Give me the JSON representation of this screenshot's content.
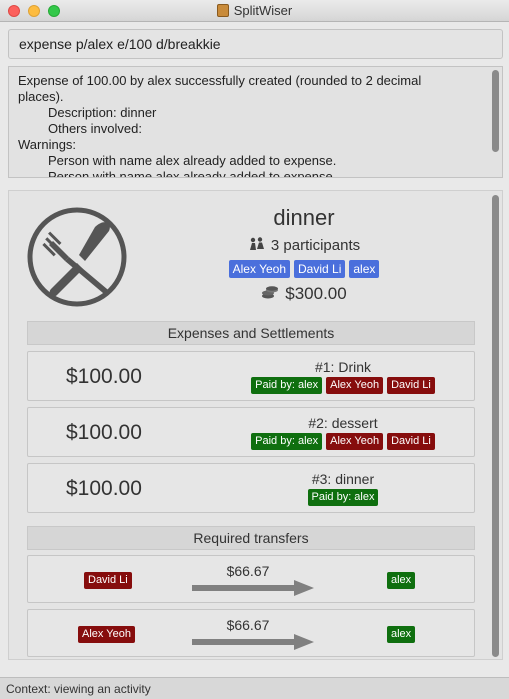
{
  "window": {
    "title": "SplitWiser"
  },
  "command": {
    "value": "expense p/alex e/100 d/breakkie"
  },
  "result": {
    "lines": [
      "Expense of 100.00 by alex successfully created (rounded to 2 decimal",
      "places).",
      "Description: dinner",
      "Others involved:",
      "Warnings:",
      "Person with name alex already added to expense.",
      "Person with name alex already added to expense."
    ]
  },
  "activity": {
    "name": "dinner",
    "participants_text": "3 participants",
    "participants": [
      "Alex Yeoh",
      "David Li",
      "alex"
    ],
    "total": "$300.00",
    "expenses_header": "Expenses and Settlements",
    "expenses": [
      {
        "amount": "$100.00",
        "title": "#1: Drink",
        "paid_by": "Paid by: alex",
        "involved": [
          "Alex Yeoh",
          "David Li"
        ]
      },
      {
        "amount": "$100.00",
        "title": "#2: dessert",
        "paid_by": "Paid by: alex",
        "involved": [
          "Alex Yeoh",
          "David Li"
        ]
      },
      {
        "amount": "$100.00",
        "title": "#3: dinner",
        "paid_by": "Paid by: alex",
        "involved": []
      }
    ],
    "transfers_header": "Required transfers",
    "transfers": [
      {
        "from": "David Li",
        "amount": "$66.67",
        "to": "alex"
      },
      {
        "from": "Alex Yeoh",
        "amount": "$66.67",
        "to": "alex"
      }
    ]
  },
  "status": {
    "text": "Context: viewing an activity"
  },
  "colors": {
    "participant_tag": "#4a6fdc",
    "paid_by_tag": "#0f6f0f",
    "involved_tag": "#860d0d"
  },
  "icons": {
    "activity": "fork-and-knife-icon",
    "participants": "people-icon",
    "total": "coins-icon",
    "transfer": "right-arrow-icon"
  }
}
